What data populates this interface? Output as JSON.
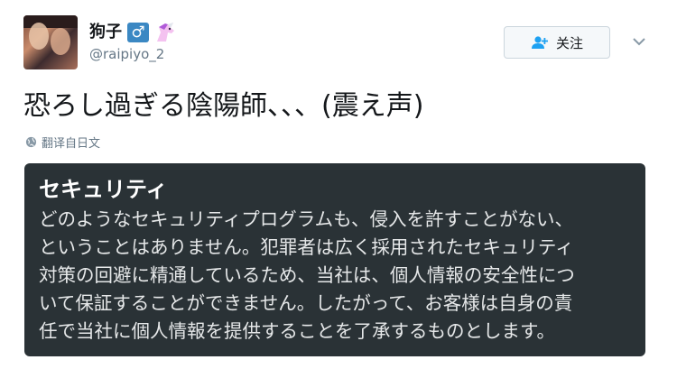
{
  "user": {
    "display_name": "狗子",
    "male_badge": "♂",
    "handle": "@raipiyo_2",
    "avatar_icon": "avatar-image",
    "badge_icon": "unicorn-icon"
  },
  "follow_button": {
    "label": "关注",
    "icon": "add-user-icon"
  },
  "tweet": {
    "text": "恐ろし過ぎる陰陽師、、、(震え声)",
    "translate_label": "翻译自日文"
  },
  "card": {
    "title": "セキュリティ",
    "lines": [
      "どのようなセキュリティプログラムも、侵入を許すことがない、",
      "ということはありません。犯罪者は広く採用されたセキュリティ",
      "対策の回避に精通しているため、当社は、個人情報の安全性につ",
      "いて保証することができません。したがって、お客様は自身の責",
      "任で当社に個人情報を提供することを了承するものとします。"
    ]
  },
  "colors": {
    "card_background": "#2a3236",
    "handle_gray": "#657786",
    "badge_blue": "#3b88c3"
  }
}
